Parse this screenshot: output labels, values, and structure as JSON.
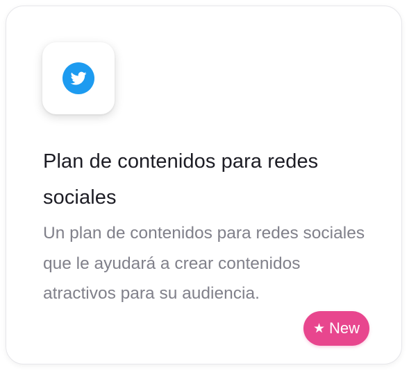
{
  "card": {
    "icon": "twitter-icon",
    "title": "Plan de contenidos para redes sociales",
    "description": "Un plan de contenidos para redes sociales que le ayudará a crear contenidos atractivos para su audiencia.",
    "badge": {
      "icon": "star-icon",
      "label": "New"
    }
  },
  "colors": {
    "twitter_blue": "#1d9bf0",
    "badge_pink": "#e8468e",
    "title": "#1c1c24",
    "description": "#80808a"
  }
}
